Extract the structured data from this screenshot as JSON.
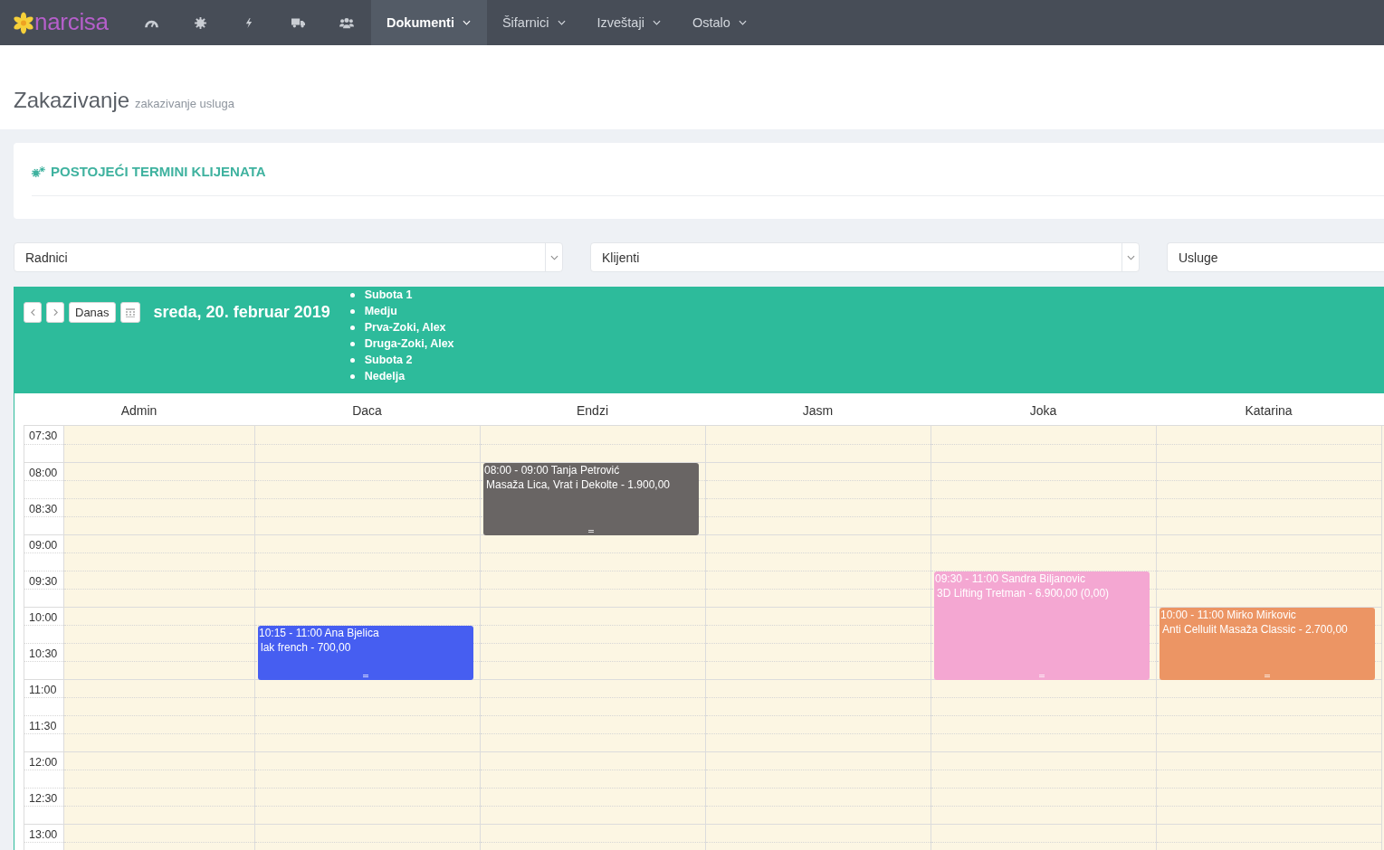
{
  "navbar": {
    "logo": "narcisa",
    "menu": [
      {
        "label": "Dokumenti",
        "selected": true
      },
      {
        "label": "Šifarnici",
        "selected": false
      },
      {
        "label": "Izveštaji",
        "selected": false
      },
      {
        "label": "Ostalo",
        "selected": false
      }
    ]
  },
  "page": {
    "title": "Zakazivanje",
    "subtitle": "zakazivanje usluga"
  },
  "card": {
    "title": "POSTOJEĆI TERMINI KLIJENATA"
  },
  "filters": [
    {
      "placeholder": "Radnici"
    },
    {
      "placeholder": "Klijenti"
    },
    {
      "placeholder": "Usluge"
    }
  ],
  "calendar": {
    "today_button": "Danas",
    "date_title": "sreda, 20. februar 2019",
    "legend": [
      "Subota 1",
      "Medju",
      "Prva-Zoki, Alex",
      "Druga-Zoki, Alex",
      "Subota 2",
      "Nedelja"
    ],
    "times": [
      "07:30",
      "08:00",
      "08:30",
      "09:00",
      "09:30",
      "10:00",
      "10:30",
      "11:00",
      "11:30",
      "12:00",
      "12:30",
      "13:00"
    ],
    "columns": [
      {
        "name": "Admin"
      },
      {
        "name": "Daca",
        "events": [
          {
            "time": "10:15 - 11:00",
            "client": "Ana Bjelica",
            "service": "lak french - 700,00",
            "color": "#465ef1"
          }
        ]
      },
      {
        "name": "Endzi",
        "events": [
          {
            "time": "08:00 - 09:00",
            "client": "Tanja Petrović",
            "service": "Masaža Lica, Vrat i Dekolte - 1.900,00",
            "color": "#696564"
          }
        ]
      },
      {
        "name": "Jasm"
      },
      {
        "name": "Joka",
        "events": [
          {
            "time": "09:30 - 11:00",
            "client": "Sandra Biljanovic",
            "service": "3D Lifting Tretman - 6.900,00 (0,00)",
            "color": "#f4a7d2"
          }
        ]
      },
      {
        "name": "Katarina",
        "events": [
          {
            "time": "10:00 - 11:00",
            "client": "Mirko Mirkovic",
            "service": "Anti Cellulit Masaža Classic - 2.700,00",
            "color": "#ec9564"
          }
        ]
      }
    ]
  }
}
